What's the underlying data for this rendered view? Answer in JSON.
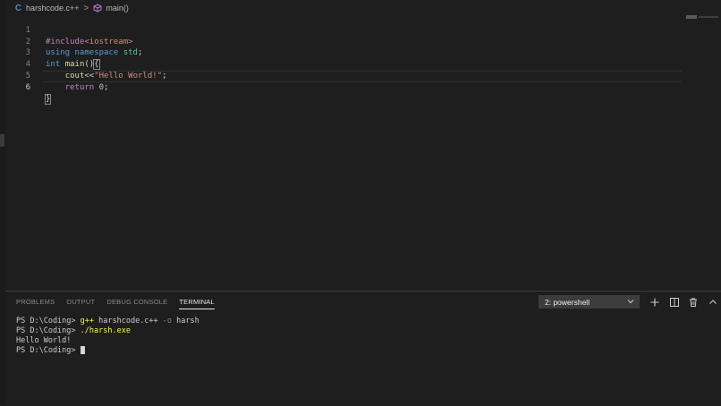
{
  "breadcrumb": {
    "file_icon": "C",
    "file": "harshcode.c++",
    "separator": ">",
    "symbol": "main()"
  },
  "editor": {
    "lines": [
      {
        "number": "1",
        "tokens": [
          "#include",
          "<iostream>"
        ]
      },
      {
        "number": "2",
        "tokens": [
          "using",
          " ",
          "namespace",
          " ",
          "std",
          ";"
        ]
      },
      {
        "number": "3",
        "tokens": [
          "int",
          " ",
          "main",
          "()",
          "{"
        ]
      },
      {
        "number": "4",
        "tokens": [
          "    ",
          "cout",
          "<<",
          "\"Hello World!\"",
          ";"
        ]
      },
      {
        "number": "5",
        "tokens": [
          "    ",
          "return",
          " ",
          "0",
          ";"
        ]
      },
      {
        "number": "6",
        "tokens": [
          "}"
        ]
      }
    ]
  },
  "panel": {
    "tabs": [
      "PROBLEMS",
      "OUTPUT",
      "DEBUG CONSOLE",
      "TERMINAL"
    ],
    "active_tab": "TERMINAL",
    "terminal_select": "2: powershell",
    "icons": [
      "plus-icon",
      "split-icon",
      "trash-icon",
      "chevron-up-icon"
    ]
  },
  "terminal": {
    "line1": {
      "prompt": "PS D:\\Coding> ",
      "cmd": "g++",
      "args": " harshcode.c++ ",
      "flag": "-o",
      "rest": " harsh"
    },
    "line2": {
      "prompt": "PS D:\\Coding> ",
      "cmd": "./harsh.exe"
    },
    "line3": {
      "output": "Hello World!"
    },
    "line4": {
      "prompt": "PS D:\\Coding> "
    }
  },
  "colors": {
    "background": "#1e1e1e",
    "keyword": "#569cd6",
    "preprocessor": "#c586c0",
    "string": "#ce9178",
    "function": "#dcdcaa",
    "namespace": "#4ec9b0",
    "number": "#b5cea8",
    "terminal_command": "#f5f543"
  }
}
